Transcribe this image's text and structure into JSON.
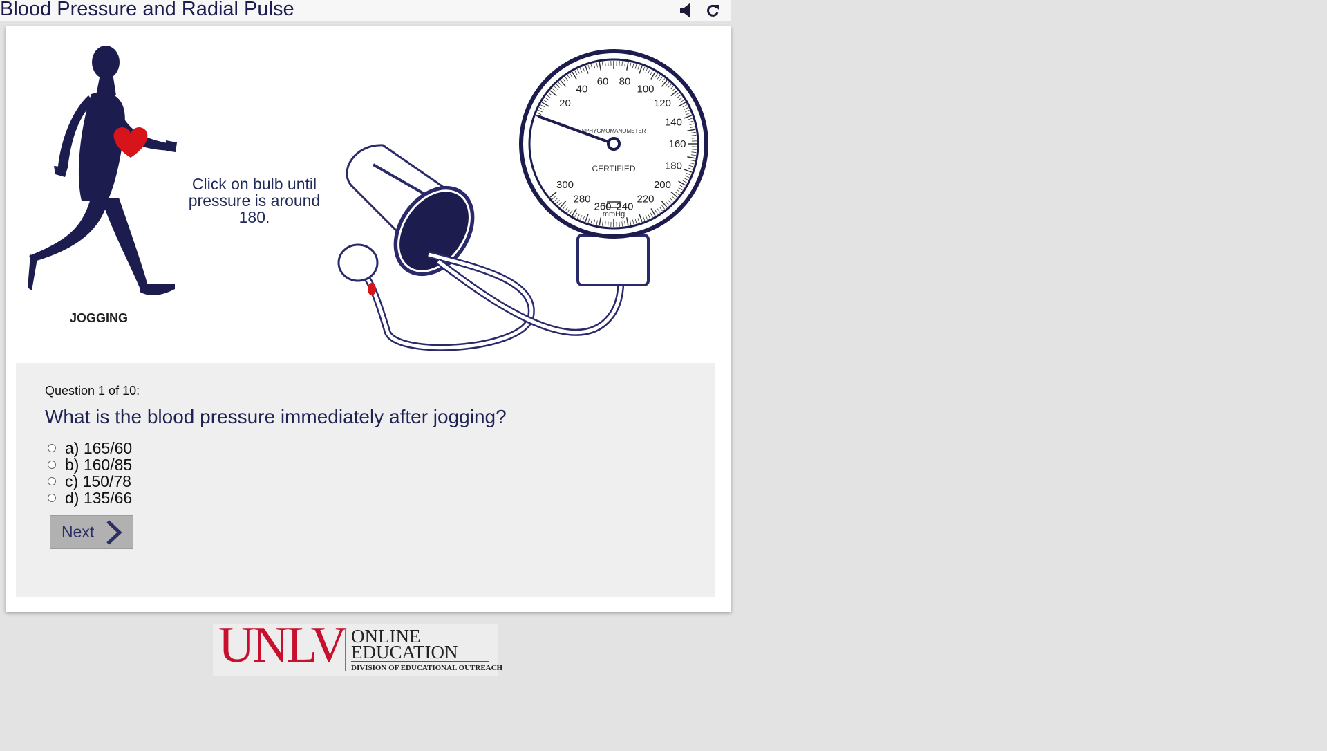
{
  "header": {
    "title": "Blood Pressure and Radial Pulse"
  },
  "colors": {
    "navy": "#1c1c4e",
    "heart": "#d7141a",
    "unlv_red": "#c8102e",
    "next_bg": "#b1b1b1"
  },
  "icons": {
    "sound": "speaker-icon",
    "reload": "reload-icon"
  },
  "figure": {
    "runner_label": "JOGGING",
    "instruction": "Click on bulb until pressure is around 180."
  },
  "gauge": {
    "ticks": [
      "20",
      "40",
      "60",
      "80",
      "100",
      "120",
      "140",
      "160",
      "180",
      "200",
      "220",
      "240",
      "260",
      "280",
      "300"
    ],
    "brand": "SPHYGMOMANOMETER",
    "certified": "CERTIFIED",
    "unit": "mmHg",
    "reading": 0
  },
  "quiz": {
    "counter": "Question 1 of 10:",
    "question": "What is the blood pressure immediately after jogging?",
    "answers": [
      "a) 165/60",
      "b) 160/85",
      "c) 150/78",
      "d) 135/66"
    ],
    "next_label": "Next"
  },
  "logo": {
    "mark": "UNLV",
    "line1": "ONLINE",
    "line2": "EDUCATION",
    "line3": "DIVISION OF EDUCATIONAL OUTREACH"
  }
}
